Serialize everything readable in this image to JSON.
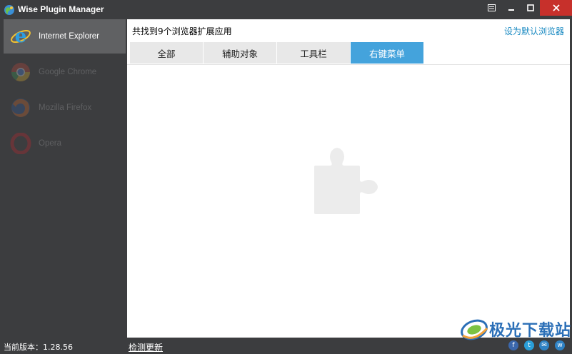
{
  "app": {
    "title": "Wise Plugin Manager"
  },
  "titlebar_icons": [
    "menu-icon",
    "minimize-icon",
    "maximize-icon",
    "close-icon"
  ],
  "sidebar": {
    "items": [
      {
        "label": "Internet Explorer",
        "icon": "internet-explorer-icon",
        "active": true
      },
      {
        "label": "Google Chrome",
        "icon": "chrome-icon",
        "active": false
      },
      {
        "label": "Mozilla Firefox",
        "icon": "firefox-icon",
        "active": false
      },
      {
        "label": "Opera",
        "icon": "opera-icon",
        "active": false
      }
    ]
  },
  "main": {
    "found_text": "共找到9个浏览器扩展应用",
    "set_default_link": "设为默认浏览器",
    "tabs": [
      {
        "label": "全部",
        "selected": false
      },
      {
        "label": "辅助对象",
        "selected": false
      },
      {
        "label": "工具栏",
        "selected": false
      },
      {
        "label": "右键菜单",
        "selected": true
      }
    ],
    "empty_state_icon": "puzzle-piece-icon"
  },
  "footer": {
    "version_label": "当前版本：",
    "version_number": "1.28.56",
    "check_update": "检测更新",
    "social": [
      {
        "icon": "facebook-icon",
        "glyph": "f"
      },
      {
        "icon": "twitter-icon",
        "glyph": "t"
      },
      {
        "icon": "mail-icon",
        "glyph": "✉"
      },
      {
        "icon": "website-icon",
        "glyph": "w"
      }
    ]
  },
  "watermark": {
    "text": "极光下载站"
  },
  "colors": {
    "window_bg": "#3c3d3f",
    "active_item": "#606163",
    "accent": "#44a3dc",
    "link": "#1a8ac2",
    "close": "#c7302b"
  }
}
